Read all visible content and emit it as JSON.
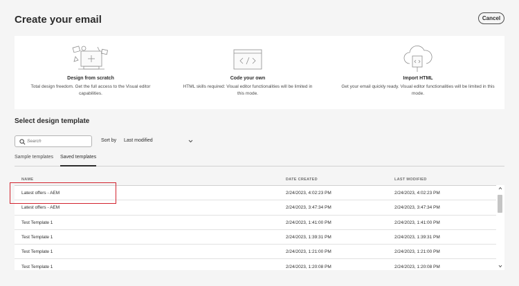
{
  "header": {
    "title": "Create your email",
    "cancel_label": "Cancel"
  },
  "cards": [
    {
      "title": "Design from scratch",
      "desc": "Total design freedom. Get the full access to the Visual editor capabilities.",
      "icon": "design-illustration-icon"
    },
    {
      "title": "Code your own",
      "desc": "HTML skills required: Visual editor functionalities will be limited in this mode.",
      "icon": "code-illustration-icon"
    },
    {
      "title": "Import HTML",
      "desc": "Get your email quickly ready. Visual editor functionalities will be limited in this mode.",
      "icon": "cloud-upload-icon"
    }
  ],
  "templates": {
    "section_title": "Select design template",
    "search_placeholder": "Search",
    "sort_label": "Sort by",
    "sort_value": "Last modified",
    "tabs": [
      "Sample templates",
      "Saved templates"
    ],
    "active_tab": "Saved templates",
    "columns": [
      "NAME",
      "DATE CREATED",
      "LAST MODIFIED"
    ],
    "rows": [
      {
        "name": "Latest offers - AEM",
        "created": "2/24/2023, 4:02:23 PM",
        "modified": "2/24/2023, 4:02:23 PM"
      },
      {
        "name": "Latest offers - AEM",
        "created": "2/24/2023, 3:47:34 PM",
        "modified": "2/24/2023, 3:47:34 PM"
      },
      {
        "name": "Test Template 1",
        "created": "2/24/2023, 1:41:00 PM",
        "modified": "2/24/2023, 1:41:00 PM"
      },
      {
        "name": "Test Template 1",
        "created": "2/24/2023, 1:39:31 PM",
        "modified": "2/24/2023, 1:39:31 PM"
      },
      {
        "name": "Test Template 1",
        "created": "2/24/2023, 1:21:00 PM",
        "modified": "2/24/2023, 1:21:00 PM"
      },
      {
        "name": "Test Template 1",
        "created": "2/24/2023, 1:20:08 PM",
        "modified": "2/24/2023, 1:20:08 PM"
      }
    ]
  },
  "colors": {
    "highlight": "#d2222d",
    "background": "#f5f5f5",
    "card_bg": "#ffffff"
  }
}
